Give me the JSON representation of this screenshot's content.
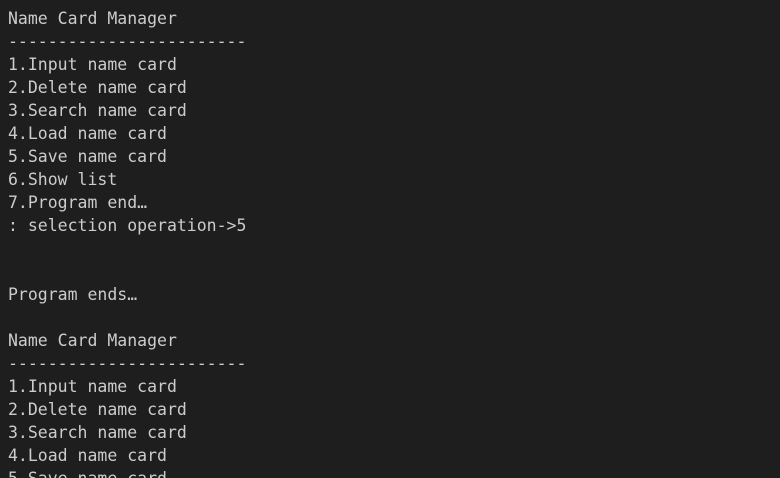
{
  "terminal": {
    "lines": [
      "Name Card Manager",
      "------------------------",
      "1.Input name card",
      "2.Delete name card",
      "3.Search name card",
      "4.Load name card",
      "5.Save name card",
      "6.Show list",
      "7.Program end…",
      ": selection operation->5",
      "",
      "",
      "Program ends…",
      "",
      "Name Card Manager",
      "------------------------",
      "1.Input name card",
      "2.Delete name card",
      "3.Search name card",
      "4.Load name card",
      "5.Save name card"
    ]
  }
}
